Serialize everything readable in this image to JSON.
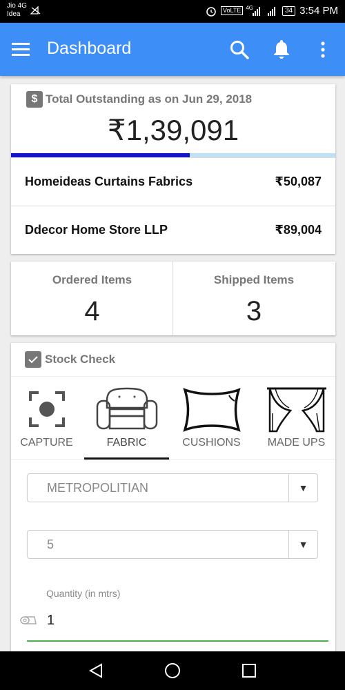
{
  "status_bar": {
    "carrier_1": "Jio 4G",
    "carrier_2": "Idea",
    "volte_badge": "VoLTE",
    "network": "4G",
    "battery": "34",
    "time": "3:54 PM"
  },
  "app_bar": {
    "title": "Dashboard",
    "icons": [
      "menu-icon",
      "search-icon",
      "bell-icon",
      "more-vert-icon"
    ]
  },
  "outstanding": {
    "title": "Total Outstanding as on Jun 29, 2018",
    "amount": "₹1,39,091",
    "progress_fraction": 0.55,
    "vendors": [
      {
        "name": "Homeideas Curtains Fabrics",
        "amount": "₹50,087"
      },
      {
        "name": "Ddecor Home Store LLP",
        "amount": "₹89,004"
      }
    ]
  },
  "items": {
    "ordered_label": "Ordered Items",
    "ordered_value": "4",
    "shipped_label": "Shipped Items",
    "shipped_value": "3"
  },
  "stock_check": {
    "title": "Stock Check",
    "categories": [
      {
        "label": "CAPTURE",
        "icon": "capture-icon"
      },
      {
        "label": "FABRIC",
        "icon": "sofa-icon"
      },
      {
        "label": "CUSHIONS",
        "icon": "cushion-icon"
      },
      {
        "label": "MADE UPS",
        "icon": "curtain-icon"
      }
    ],
    "active_category": "FABRIC",
    "select_collection": "METROPOLITIAN",
    "select_number": "5",
    "quantity_label": "Quantity (in mtrs)",
    "quantity_value": "1"
  },
  "colors": {
    "app_bar": "#3e8ef7",
    "progress_fill": "#1515c8",
    "progress_track": "#bfe1f5",
    "input_underline": "#4caf50"
  }
}
